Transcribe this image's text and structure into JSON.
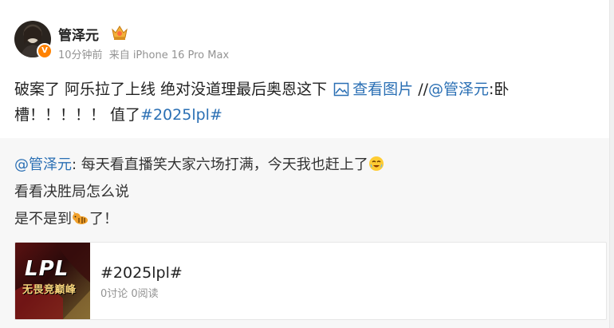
{
  "user": {
    "name": "管泽元",
    "verified_mark": "V",
    "badge_icon": "crown-badge-icon",
    "time": "10分钟前",
    "source": "来自 iPhone 16 Pro Max"
  },
  "post": {
    "text_part1": "破案了 阿乐拉了上线 绝对没道理最后奥恩这下",
    "view_image_label": "查看图片",
    "repost_sep": " //",
    "mention": "@管泽元",
    "text_part2": ":卧槽！！！！！ 值了",
    "hashtag": "#2025lpl#"
  },
  "repost": {
    "mention": "@管泽元",
    "line1": ": 每天看直播笑大家六场打满，今天我也赶上了",
    "line1_emoji": "crying-laugh-emoji",
    "line2": "看看决胜局怎么说",
    "line3_part1": "是不是到",
    "line3_emoji": "tiger-emoji",
    "line3_part2": "了！"
  },
  "topic_card": {
    "thumb_logo": "LPL",
    "thumb_subtitle": "无畏竞巅峰",
    "title": "#2025lpl#",
    "stats": "0讨论 0阅读"
  },
  "colors": {
    "link": "#2a6fb4",
    "meta": "#939393",
    "verified": "#ff8200",
    "repost_bg": "#f7f7f7"
  }
}
